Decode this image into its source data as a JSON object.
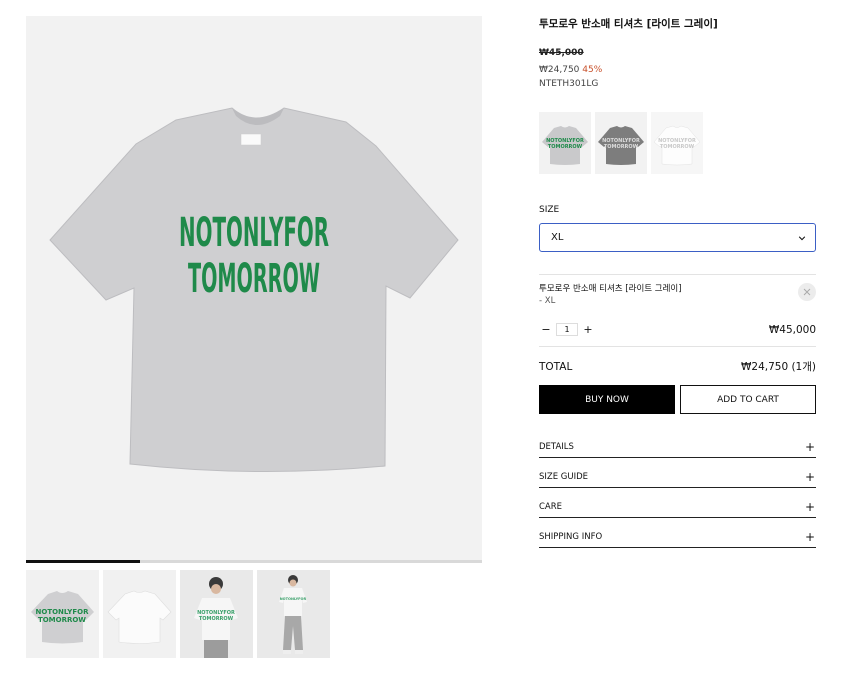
{
  "gallery": {
    "progress": 0.25,
    "thumbnails": [
      {
        "name": "thumb-front-gray"
      },
      {
        "name": "thumb-back-white"
      },
      {
        "name": "thumb-model-white"
      },
      {
        "name": "thumb-model-full"
      }
    ],
    "print_line1": "NOTONLYFOR",
    "print_line2": "TOMORROW",
    "shirt_color": "#cfcfd1",
    "print_color": "#1f8a4a"
  },
  "product": {
    "title": "투모로우 반소매 티셔츠 [라이트 그레이]",
    "original_price": "₩45,000",
    "sale_price": "₩24,750",
    "discount": "45%",
    "sku": "NTETH301LG",
    "swatches": [
      {
        "color": "#c9c9cb"
      },
      {
        "color": "#7d7d7d"
      },
      {
        "color": "#f4f4f4"
      }
    ]
  },
  "size": {
    "label": "SIZE",
    "selected": "XL"
  },
  "selection": {
    "name": "투모로우 반소매 티셔츠 [라이트 그레이]",
    "option": "- XL",
    "quantity": "1",
    "minus": "−",
    "plus": "+",
    "line_price": "₩45,000"
  },
  "total": {
    "label": "TOTAL",
    "value": "₩24,750 (1개)"
  },
  "actions": {
    "buy_now": "BUY NOW",
    "add_to_cart": "ADD TO CART"
  },
  "accordion": [
    {
      "label": "DETAILS",
      "icon": "+"
    },
    {
      "label": "SIZE GUIDE",
      "icon": "+"
    },
    {
      "label": "CARE",
      "icon": "+"
    },
    {
      "label": "SHIPPING INFO",
      "icon": "+"
    }
  ],
  "colors": {
    "accent_border": "#3b5fc5",
    "discount": "#c8502a"
  }
}
